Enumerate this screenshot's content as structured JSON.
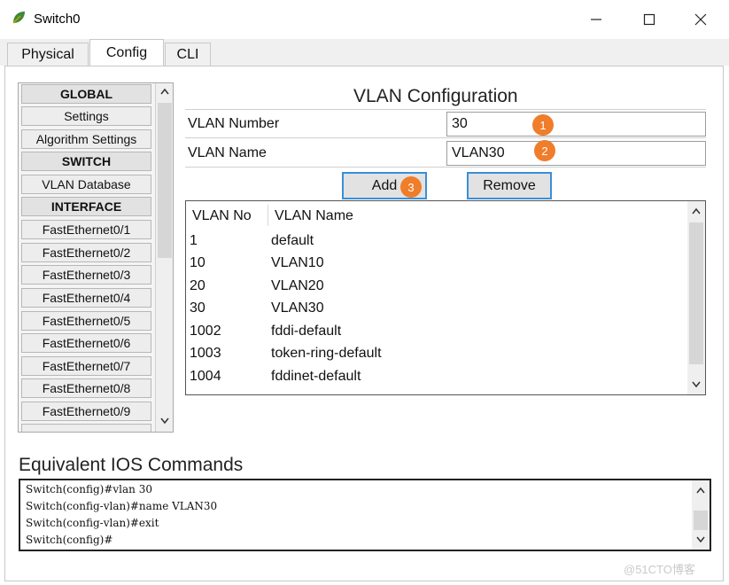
{
  "window": {
    "title": "Switch0"
  },
  "tabs": [
    {
      "label": "Physical"
    },
    {
      "label": "Config"
    },
    {
      "label": "CLI"
    }
  ],
  "sidebar": {
    "items": [
      {
        "label": "GLOBAL",
        "type": "header"
      },
      {
        "label": "Settings",
        "type": "item"
      },
      {
        "label": "Algorithm Settings",
        "type": "item"
      },
      {
        "label": "SWITCH",
        "type": "header"
      },
      {
        "label": "VLAN Database",
        "type": "item"
      },
      {
        "label": "INTERFACE",
        "type": "header"
      },
      {
        "label": "FastEthernet0/1",
        "type": "item"
      },
      {
        "label": "FastEthernet0/2",
        "type": "item"
      },
      {
        "label": "FastEthernet0/3",
        "type": "item"
      },
      {
        "label": "FastEthernet0/4",
        "type": "item"
      },
      {
        "label": "FastEthernet0/5",
        "type": "item"
      },
      {
        "label": "FastEthernet0/6",
        "type": "item"
      },
      {
        "label": "FastEthernet0/7",
        "type": "item"
      },
      {
        "label": "FastEthernet0/8",
        "type": "item"
      },
      {
        "label": "FastEthernet0/9",
        "type": "item"
      }
    ]
  },
  "vlan_config": {
    "title": "VLAN Configuration",
    "number_label": "VLAN Number",
    "number_value": "30",
    "name_label": "VLAN Name",
    "name_value": "VLAN30",
    "add_label": "Add",
    "remove_label": "Remove",
    "badges": [
      "1",
      "2",
      "3"
    ],
    "badge_color": "#f07d2a",
    "button_border_color": "#3a8fd8"
  },
  "vlan_table": {
    "headers": [
      "VLAN No",
      "VLAN Name"
    ],
    "rows": [
      [
        "1",
        "default"
      ],
      [
        "10",
        "VLAN10"
      ],
      [
        "20",
        "VLAN20"
      ],
      [
        "30",
        "VLAN30"
      ],
      [
        "1002",
        "fddi-default"
      ],
      [
        "1003",
        "token-ring-default"
      ],
      [
        "1004",
        "fddinet-default"
      ]
    ]
  },
  "ios": {
    "title": "Equivalent IOS Commands",
    "lines": [
      "Switch(config)#vlan 30",
      "Switch(config-vlan)#name VLAN30",
      "Switch(config-vlan)#exit",
      "Switch(config)#"
    ]
  },
  "watermark": "@51CTO博客"
}
